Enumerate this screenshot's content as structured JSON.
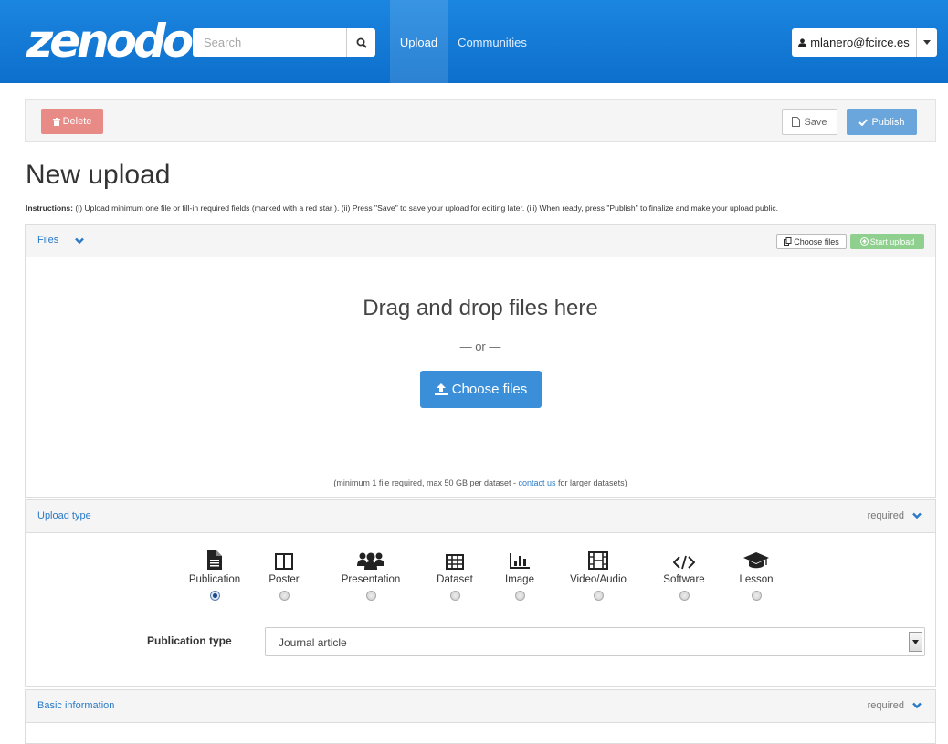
{
  "header": {
    "logo_text": "zenodo",
    "search_placeholder": "Search",
    "nav": {
      "upload": "Upload",
      "communities": "Communities"
    },
    "user_email": "mlanero@fcirce.es"
  },
  "actions": {
    "delete_label": "Delete",
    "save_label": "Save",
    "publish_label": "Publish"
  },
  "page": {
    "title": "New upload",
    "instructions_prefix": "Instructions:",
    "instructions_text": " (i) Upload minimum one file or fill-in required fields (marked with a red star ). (ii) Press \"Save\" to save your upload for editing later. (iii) When ready, press \"Publish\" to finalize and make your upload public."
  },
  "files_panel": {
    "title": "Files",
    "choose_files_small": "Choose files",
    "start_upload": "Start upload",
    "drop_text": "Drag and drop files here",
    "or_text": "— or —",
    "choose_files_big": "Choose files",
    "note_before": "(minimum 1 file required, max 50 GB per dataset - ",
    "note_link": "contact us",
    "note_after": " for larger datasets)"
  },
  "upload_type_panel": {
    "title": "Upload type",
    "required": "required",
    "types": [
      {
        "label": "Publication",
        "icon": "file-text-icon",
        "selected": true
      },
      {
        "label": "Poster",
        "icon": "columns-icon",
        "selected": false
      },
      {
        "label": "Presentation",
        "icon": "group-icon",
        "selected": false
      },
      {
        "label": "Dataset",
        "icon": "table-icon",
        "selected": false
      },
      {
        "label": "Image",
        "icon": "bar-chart-icon",
        "selected": false
      },
      {
        "label": "Video/Audio",
        "icon": "film-icon",
        "selected": false
      },
      {
        "label": "Software",
        "icon": "code-icon",
        "selected": false
      },
      {
        "label": "Lesson",
        "icon": "graduation-cap-icon",
        "selected": false
      }
    ],
    "publication_type_label": "Publication type",
    "publication_type_value": "Journal article"
  },
  "basic_info_panel": {
    "title": "Basic information",
    "required": "required"
  },
  "colors": {
    "navbar": "#1479d8",
    "link": "#2a7ac8",
    "delete": "#e88a86",
    "publish": "#6aa6dc",
    "start_upload": "#8fd08f",
    "choose_files": "#3b8ed8"
  }
}
